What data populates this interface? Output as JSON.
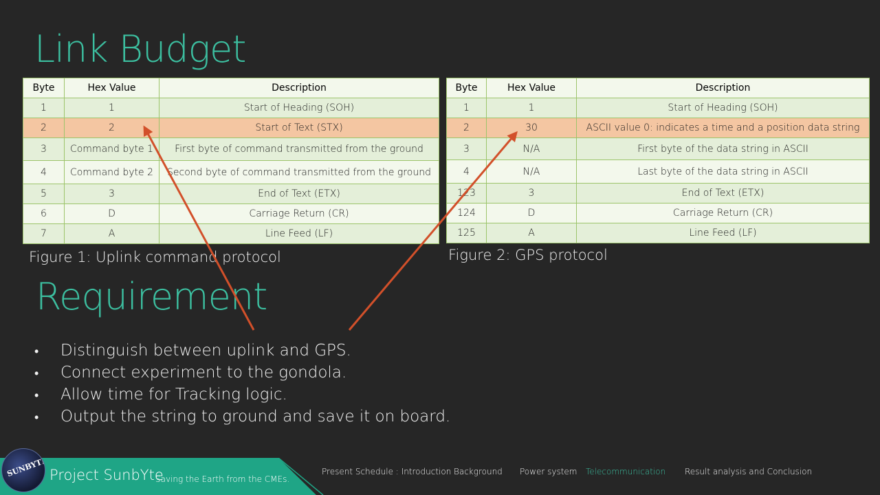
{
  "slide": {
    "title": "Link Budget",
    "requirement_title": "Requirement"
  },
  "table1": {
    "headers": [
      "Byte",
      "Hex Value",
      "Description"
    ],
    "rows": [
      [
        "1",
        "1",
        "Start of Heading (SOH)"
      ],
      [
        "2",
        "2",
        "Start of Text (STX)"
      ],
      [
        "3",
        "Command byte 1",
        "First byte of command transmitted from the ground"
      ],
      [
        "4",
        "Command byte 2",
        "Second byte of command transmitted from the ground"
      ],
      [
        "5",
        "3",
        "End of Text (ETX)"
      ],
      [
        "6",
        "D",
        "Carriage Return (CR)"
      ],
      [
        "7",
        "A",
        "Line Feed (LF)"
      ]
    ],
    "caption": "Figure 1: Uplink command protocol"
  },
  "table2": {
    "headers": [
      "Byte",
      "Hex Value",
      "Description"
    ],
    "rows": [
      [
        "1",
        "1",
        "Start of Heading (SOH)"
      ],
      [
        "2",
        "30",
        "ASCII value 0: indicates a time and a position data string"
      ],
      [
        "3",
        "N/A",
        "First byte of the data string in ASCII"
      ],
      [
        "4",
        "N/A",
        "Last byte of the data string in ASCII"
      ],
      [
        "123",
        "3",
        "End of Text (ETX)"
      ],
      [
        "124",
        "D",
        "Carriage Return (CR)"
      ],
      [
        "125",
        "A",
        "Line Feed (LF)"
      ]
    ],
    "caption": "Figure 2: GPS protocol"
  },
  "bullets": [
    "Distinguish between uplink and GPS.",
    "Connect experiment to the gondola.",
    "Allow time for Tracking logic.",
    "Output the string to ground and save it on board."
  ],
  "bullet_glyph": "•",
  "footer": {
    "logo_text": "SUNBYTE",
    "project": "Project SunbYte",
    "tagline": "Saving the Earth from the CMEs.",
    "nav": [
      "Present Schedule : Introduction",
      "Background",
      "Power system",
      "Telecommunication",
      "Result analysis and Conclusion"
    ],
    "active_nav": "Telecommunication"
  },
  "colors": {
    "background": "#262626",
    "accent_teal": "#3cbfa0",
    "highlight_row": "#f4c6a2",
    "arrow": "#d2502a",
    "footer_green": "#1fa586"
  },
  "highlighted_row_index": 1
}
